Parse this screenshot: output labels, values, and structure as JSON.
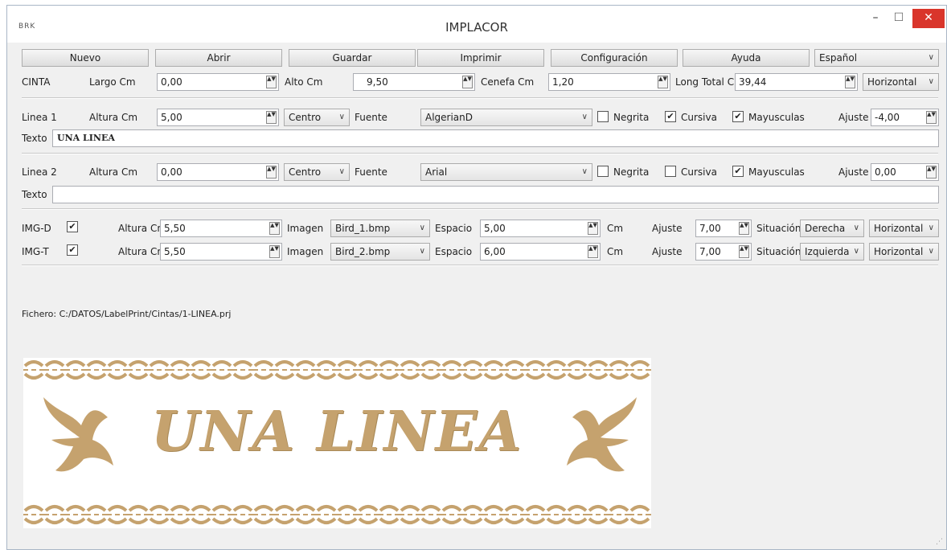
{
  "window": {
    "title": "IMPLACOR",
    "icon_text": "IMPLACOR",
    "minimize": "–",
    "maximize": "☐",
    "close": "✕"
  },
  "toolbar": {
    "nuevo": "Nuevo",
    "abrir": "Abrir",
    "guardar": "Guardar",
    "imprimir": "Imprimir",
    "configuracion": "Configuración",
    "ayuda": "Ayuda",
    "language": "Español"
  },
  "cinta": {
    "label": "CINTA",
    "largo_label": "Largo Cm",
    "largo": "0,00",
    "alto_label": "Alto Cm",
    "alto": "9,50",
    "cenefa_label": "Cenefa Cm",
    "cenefa": "1,20",
    "long_total_label": "Long Total Cm",
    "long_total": "39,44",
    "orientation": "Horizontal"
  },
  "linea1": {
    "label": "Linea 1",
    "altura_label": "Altura Cm",
    "altura": "5,00",
    "align": "Centro",
    "fuente_label": "Fuente",
    "fuente": "AlgerianD",
    "negrita_label": "Negrita",
    "negrita": false,
    "cursiva_label": "Cursiva",
    "cursiva": true,
    "mayusculas_label": "Mayusculas",
    "mayusculas": true,
    "ajuste_label": "Ajuste",
    "ajuste": "-4,00",
    "texto_label": "Texto",
    "texto": "UNA LINEA"
  },
  "linea2": {
    "label": "Linea 2",
    "altura_label": "Altura Cm",
    "altura": "0,00",
    "align": "Centro",
    "fuente_label": "Fuente",
    "fuente": "Arial",
    "negrita_label": "Negrita",
    "negrita": false,
    "cursiva_label": "Cursiva",
    "cursiva": false,
    "mayusculas_label": "Mayusculas",
    "mayusculas": true,
    "ajuste_label": "Ajuste",
    "ajuste": "0,00",
    "texto_label": "Texto",
    "texto": ""
  },
  "img_d": {
    "label": "IMG-D",
    "checked": true,
    "altura_label": "Altura Cm",
    "altura": "5,50",
    "imagen_label": "Imagen",
    "imagen": "Bird_1.bmp",
    "espacio_label": "Espacio",
    "espacio": "5,00",
    "cm_label": "Cm",
    "ajuste_label": "Ajuste",
    "ajuste": "7,00",
    "situacion_label": "Situación",
    "situacion": "Derecha",
    "orientation": "Horizontal"
  },
  "img_t": {
    "label": "IMG-T",
    "checked": true,
    "altura_label": "Altura Cm",
    "altura": "5,50",
    "imagen_label": "Imagen",
    "imagen": "Bird_2.bmp",
    "espacio_label": "Espacio",
    "espacio": "6,00",
    "cm_label": "Cm",
    "ajuste_label": "Ajuste",
    "ajuste": "7,00",
    "situacion_label": "Situación",
    "situacion": "Izquierda",
    "orientation": "Horizontal"
  },
  "fichero": "Fichero: C:/DATOS/LabelPrint/Cintas/1-LINEA.prj",
  "preview": {
    "text": "UNA LINEA",
    "color": "#c5a26e"
  },
  "icons": {
    "check": "✔",
    "spin": "▲▼",
    "chevron": "∨"
  }
}
